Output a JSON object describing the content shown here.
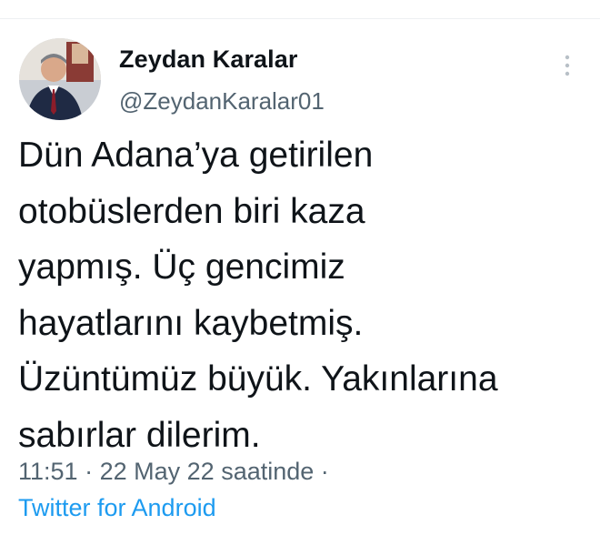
{
  "tweet": {
    "author": {
      "display_name": "Zeydan Karalar",
      "handle": "@ZeydanKaralar01",
      "avatar_icon": "profile-photo"
    },
    "text_lines": [
      "Dün Adana’ya getirilen",
      "otobüslerden biri kaza",
      "yapmış. Üç gencimiz",
      "hayatlarını kaybetmiş.",
      "Üzüntümüz büyük. Yakınlarına",
      "sabırlar dilerim."
    ],
    "meta": {
      "time": "11:51",
      "separator": "·",
      "date": "22 May 22",
      "suffix": "saatinde"
    },
    "source": "Twitter for Android",
    "more_icon": "more-vertical-icon"
  },
  "colors": {
    "text_primary": "#0f1419",
    "text_secondary": "#536471",
    "link": "#1d9bf0",
    "background": "#ffffff"
  }
}
